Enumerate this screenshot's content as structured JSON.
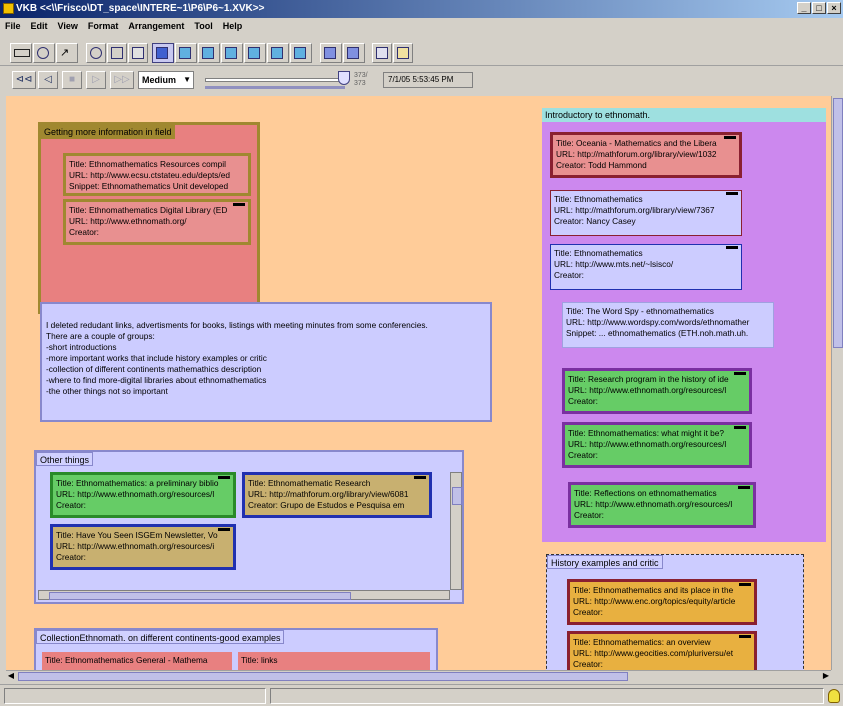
{
  "window": {
    "title": "VKB  <<\\\\Frisco\\DT_space\\INTERE~1\\P6\\P6~1.XVK>>"
  },
  "menu": [
    "File",
    "Edit",
    "View",
    "Format",
    "Arrangement",
    "Tool",
    "Help"
  ],
  "toolbar_icons": [
    "rectangle-tool-icon",
    "freehand-tool-icon",
    "arrow-tool-icon",
    "search-icon",
    "copy-icon",
    "window-icon",
    "layout-1-icon",
    "layout-2-icon",
    "layout-3-icon",
    "layout-4-icon",
    "layout-5-icon",
    "layout-6-icon",
    "layout-7-icon",
    "grid-2x2-icon",
    "grid-2x1-icon",
    "image-icon",
    "edit-icon"
  ],
  "nav": {
    "speed": "Medium",
    "slider_value": "373/",
    "slider_max": "373",
    "slider_fraction": 1.0,
    "timestamp": "7/1/05 5:53:45 PM"
  },
  "collections": {
    "getting_more": {
      "title": "Getting more information in field",
      "nodes": [
        {
          "lines": [
            "Title: Ethnomathematics Resources compil",
            "URL: http://www.ecsu.ctstateu.edu/depts/ed",
            "Snippet: Ethnomathematics Unit developed"
          ]
        },
        {
          "lines": [
            "Title:  Ethnomathematics Digital Library (ED",
            "URL:  http://www.ethnomath.org/",
            "Creator:"
          ]
        }
      ]
    },
    "note": {
      "lines": [
        "I deleted redudant links, advertisments for books, listings with meeting minutes from some conferencies.",
        "There are a couple of groups:",
        "-short introductions",
        "-more important works that include history examples or critic",
        "-collection of different continents mathemathics description",
        "-where to find more-digital libraries about ethnomathematics",
        "-the other things not so important"
      ]
    },
    "other_things": {
      "title": "Other things",
      "nodes": [
        {
          "lines": [
            "Title: Ethnomathematics: a preliminary biblio",
            "URL: http://www.ethnomath.org/resources/l",
            "Creator:"
          ]
        },
        {
          "lines": [
            "Title:  Ethnomathematic Research",
            "URL:  http://mathforum.org/library/view/6081",
            "Creator:  Grupo de Estudos e Pesquisa em"
          ]
        },
        {
          "lines": [
            "Title: Have You Seen ISGEm Newsletter, Vo",
            "URL: http://www.ethnomath.org/resources/i",
            "Creator:"
          ]
        }
      ]
    },
    "collection_continents": {
      "title": "CollectionEthnomath. on different continents-good examples",
      "nodes": [
        {
          "lines": [
            "Title: Ethnomathematics General - Mathema"
          ]
        },
        {
          "lines": [
            "Title: links"
          ]
        }
      ]
    },
    "introductory": {
      "title": "Introductory to ethnomath.",
      "nodes": [
        {
          "lines": [
            "Title:  Oceania - Mathematics and the Libera",
            "URL:  http://mathforum.org/library/view/1032",
            "Creator:  Todd Hammond"
          ]
        },
        {
          "lines": [
            "Title:  Ethnomathematics",
            "URL:  http://mathforum.org/library/view/7367",
            "Creator:  Nancy Casey"
          ]
        },
        {
          "lines": [
            "Title: Ethnomathematics",
            "URL: http://www.mts.net/~lsisco/",
            "Creator:"
          ]
        },
        {
          "lines": [
            "Title: The Word Spy - ethnomathematics",
            "URL: http://www.wordspy.com/words/ethnomather",
            "Snippet:  ... ethnomathematics (ETH.noh.math.uh."
          ]
        },
        {
          "lines": [
            "Title: Research program in the history of ide",
            "URL: http://www.ethnomath.org/resources/l",
            "Creator:"
          ]
        },
        {
          "lines": [
            "Title: Ethnomathematics: what might it be?",
            "URL: http://www.ethnomath.org/resources/l",
            "Creator:"
          ]
        },
        {
          "lines": [
            "Title: Reflections on ethnomathematics",
            "URL: http://www.ethnomath.org/resources/l",
            "Creator:"
          ]
        }
      ]
    },
    "history": {
      "title": "History examples and critic",
      "nodes": [
        {
          "lines": [
            "Title: Ethnomathematics and its place in the",
            "URL: http://www.enc.org/topics/equity/article",
            "Creator:"
          ]
        },
        {
          "lines": [
            "Title: Ethnomathematics: an overview",
            "URL: http://www.geocities.com/pluriversu/et",
            "Creator:"
          ]
        }
      ]
    }
  },
  "colors": {
    "workspace": "#ffcc99",
    "olive_collection": "#a08830",
    "salmon": "#e88080",
    "purple_collection": "#cc88ee",
    "lavender": "#ccccff",
    "green_node": "#66cc66",
    "tan_node": "#c8b070"
  }
}
